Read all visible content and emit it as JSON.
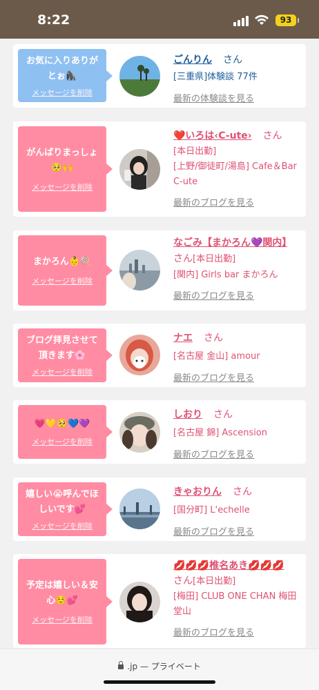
{
  "status": {
    "time": "8:22",
    "battery": "93"
  },
  "cards": [
    {
      "bubble_color": "blue",
      "message": "お気に入りありがとぉ🦍",
      "delete_label": "メッセージを削除",
      "name": "ごんりん",
      "san": "さん",
      "details": [
        "[三重県]体験談 77件"
      ],
      "link": "最新の体験談を見る",
      "avatar": "avatar-gonrin"
    },
    {
      "bubble_color": "pink",
      "message": "がんばりまっしょ🥺🙌",
      "delete_label": "メッセージを削除",
      "name": "❤️いろは‹C-ute›",
      "san": "さん",
      "details": [
        "[本日出勤]",
        "[上野/御徒町/湯島] Cafe＆Bar C-ute"
      ],
      "link": "最新のブログを見る",
      "avatar": "avatar-iroha"
    },
    {
      "bubble_color": "pink",
      "message": "まかろん👶🍭",
      "delete_label": "メッセージを削除",
      "name": "なごみ【まかろん💜関内】",
      "san": "さん",
      "details": [
        "[本日出勤]",
        "[関内] Girls bar まかろん"
      ],
      "link": "最新のブログを見る",
      "avatar": "avatar-nagomi"
    },
    {
      "bubble_color": "pink",
      "message": "ブログ拝見させて頂きます🌸",
      "delete_label": "メッセージを削除",
      "name": "ナエ",
      "san": "さん",
      "details": [
        "[名古屋 金山] amour"
      ],
      "link": "最新のブログを見る",
      "avatar": "avatar-nae"
    },
    {
      "bubble_color": "pink",
      "message": "💗💛🥺💙💜",
      "delete_label": "メッセージを削除",
      "name": "しおり",
      "san": "さん",
      "details": [
        "[名古屋 錦] Ascension"
      ],
      "link": "最新のブログを見る",
      "avatar": "avatar-shiori"
    },
    {
      "bubble_color": "pink",
      "message": "嬉しい😭呼んでほしいです💕",
      "delete_label": "メッセージを削除",
      "name": "きゃおりん",
      "san": "さん",
      "details": [
        "[国分町] L'echelle"
      ],
      "link": "最新のブログを見る",
      "avatar": "avatar-kyaorin"
    },
    {
      "bubble_color": "pink",
      "message": "予定は嬉しい＆安心☺️💕",
      "delete_label": "メッセージを削除",
      "name": "💋💋💋椎名あき💋💋💋",
      "san": "さん",
      "details": [
        "[本日出勤]",
        "[梅田] CLUB ONE CHAN 梅田堂山"
      ],
      "link": "最新のブログを見る",
      "avatar": "avatar-aki"
    }
  ],
  "urlbar": {
    "text": ".jp — プライベート"
  }
}
